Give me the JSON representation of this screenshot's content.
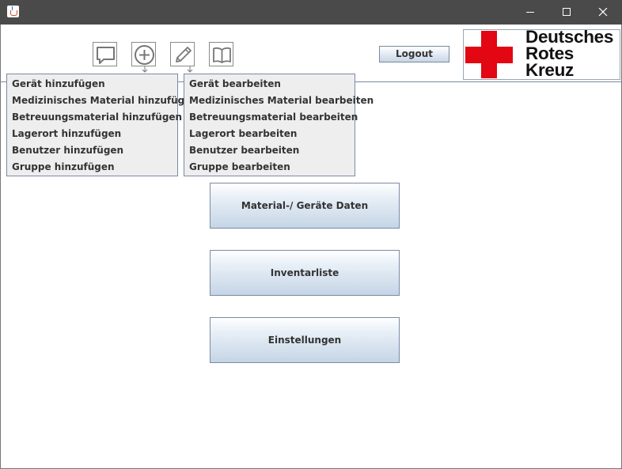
{
  "window": {
    "icon": "java-cup-icon",
    "controls": [
      "minimize-icon",
      "maximize-icon",
      "close-icon"
    ]
  },
  "toolbar": {
    "icons": [
      "message-icon",
      "plus-circle-icon",
      "pencil-icon",
      "book-icon"
    ],
    "logout_label": "Logout"
  },
  "logo": {
    "line1": "Deutsches",
    "line2": "Rotes",
    "line3": "Kreuz",
    "cross_color": "#e30613"
  },
  "add_menu": {
    "items": [
      "Gerät hinzufügen",
      "Medizinisches Material hinzufügen",
      "Betreuungsmaterial hinzufügen",
      "Lagerort hinzufügen",
      "Benutzer hinzufügen",
      "Gruppe hinzufügen"
    ]
  },
  "edit_menu": {
    "items": [
      "Gerät bearbeiten",
      "Medizinisches Material bearbeiten",
      "Betreuungsmaterial bearbeiten",
      "Lagerort bearbeiten",
      "Benutzer bearbeiten",
      "Gruppe bearbeiten"
    ]
  },
  "main": {
    "material_label": "Material-/ Geräte Daten",
    "inventory_label": "Inventarliste",
    "settings_label": "Einstellungen"
  },
  "colors": {
    "titlebar": "#4a4a4a",
    "accent_red": "#e30613",
    "button_gradient_end": "#c5d5e6"
  }
}
